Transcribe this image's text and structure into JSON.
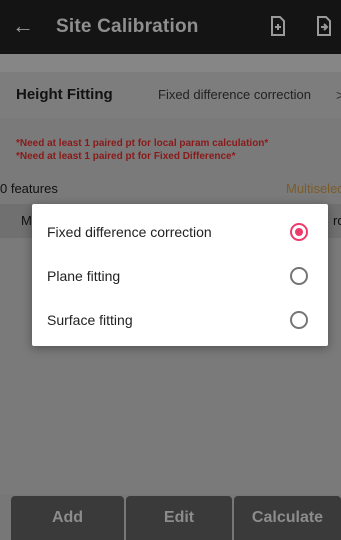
{
  "appbar": {
    "title": "Site Calibration",
    "back_icon": "back-arrow-icon",
    "import_icon": "file-import-icon",
    "export_icon": "file-export-icon"
  },
  "height_fitting": {
    "label": "Height Fitting",
    "value": "Fixed difference correction",
    "chevron": ">"
  },
  "warnings": [
    "*Need at least 1 paired pt for local param calculation*",
    "*Need at least 1 paired pt for Fixed Difference*"
  ],
  "features": {
    "count_text": "0 features",
    "multiselect": "Multiselect"
  },
  "columns": {
    "left": "M",
    "right": "rd"
  },
  "dialog": {
    "options": [
      {
        "label": "Fixed difference correction",
        "selected": true
      },
      {
        "label": "Plane fitting",
        "selected": false
      },
      {
        "label": "Surface fitting",
        "selected": false
      }
    ],
    "accent": "#ee3b6b"
  },
  "buttons": {
    "add": "Add",
    "edit": "Edit",
    "calculate": "Calculate"
  }
}
